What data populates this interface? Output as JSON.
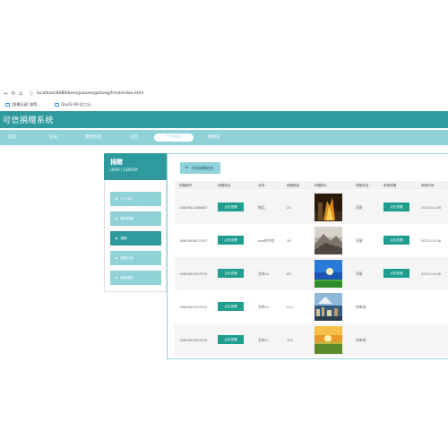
{
  "browser": {
    "url": "localhost:8080/kexinjuanzengxitong/front/index.html"
  },
  "bookmarks": [
    {
      "label": "[投稿记录] 推荐..."
    },
    {
      "label": "Day02-09 员工分..."
    }
  ],
  "site": {
    "title": "可信捐赠系统"
  },
  "nav": {
    "items": [
      {
        "label": "首页"
      },
      {
        "label": "论坛"
      },
      {
        "label": "案例信息"
      },
      {
        "label": "公告"
      },
      {
        "label": "个人中心"
      },
      {
        "label": "购物车"
      }
    ],
    "active_index": 4
  },
  "sidebar": {
    "title": "捐赠",
    "subtitle": "USER / CENTER",
    "items": [
      {
        "label": "个人中心"
      },
      {
        "label": "我的收藏"
      },
      {
        "label": "捐赠"
      },
      {
        "label": "我的订单"
      },
      {
        "label": "我的地址"
      }
    ],
    "active_index": 2
  },
  "main": {
    "add_button_label": "添加捐赠信息",
    "columns": [
      "捐赠编号",
      "捐赠物品",
      "名称",
      "捐赠数量",
      "捐赠图片",
      "捐赠状态",
      "审核捐赠",
      "审核时间"
    ],
    "view_label": "点击查看",
    "rows": [
      {
        "id": "1680941468687",
        "name": "物品",
        "qty": "20",
        "status": "同意",
        "reviewed": true,
        "time": "2023-04-08",
        "image": "fire"
      },
      {
        "id": "1680940657207",
        "name": "ooo的书包",
        "qty": "20",
        "status": "同意",
        "reviewed": true,
        "time": "2023-04-08",
        "image": "mountain"
      },
      {
        "id": "1680940557910",
        "name": "名称14",
        "qty": "89",
        "status": "同意",
        "reviewed": true,
        "time": "2023-04-08",
        "image": "sky"
      },
      {
        "id": "1680940557912",
        "name": "名称13",
        "qty": "211",
        "status": "待审核",
        "reviewed": false,
        "time": "",
        "image": "city"
      },
      {
        "id": "1680940557825",
        "name": "名称11",
        "qty": "101",
        "status": "待审核",
        "reviewed": false,
        "time": "",
        "image": "sunset"
      }
    ]
  },
  "colors": {
    "primary": "#2e9a9e",
    "light": "#8fd3d8",
    "button": "#1f9e8f"
  }
}
